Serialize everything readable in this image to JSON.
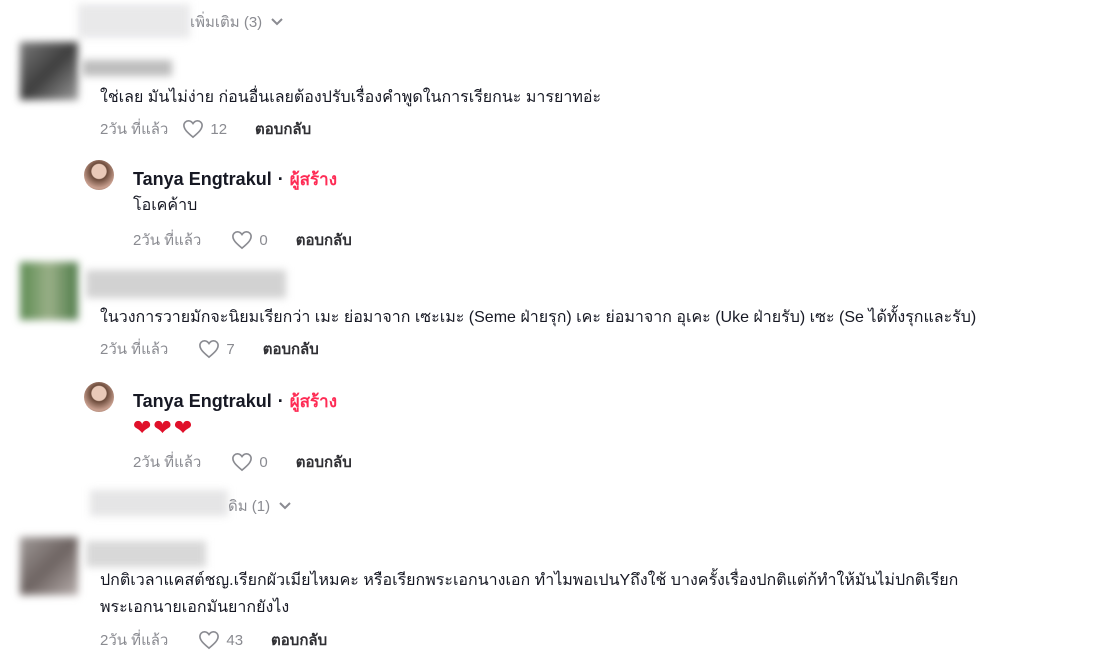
{
  "threads": [
    {
      "more_replies": "เพิ่มเติม (3)",
      "text": "ใช่เลย มันไม่ง่าย ก่อนอื่นเลยต้องปรับเรื่องคำพูดในการเรียกนะ มารยาทอ่ะ",
      "time": "2วัน ที่แล้ว",
      "likes": "12",
      "reply_label": "ตอบกลับ"
    },
    {
      "text": "ในวงการวายมักจะนิยมเรียกว่า เมะ ย่อมาจาก เซะเมะ (Seme ฝ่ายรุก) เคะ ย่อมาจาก อุเคะ (Uke ฝ่ายรับ) เซะ (Se ได้ทั้งรุกและรับ)",
      "time": "2วัน ที่แล้ว",
      "likes": "7",
      "reply_label": "ตอบกลับ"
    },
    {
      "more_replies": "ดิม (1)",
      "text_line1": "ปกติเวลาแคสต์ชญ.เรียกผัวเมียไหมคะ หรือเรียกพระเอกนางเอก ทำไมพอเปนYถึงใช้ บางครั้งเรื่องปกติแต่ก้ทำให้มันไม่ปกติเรียก",
      "text_line2": "พระเอกนายเอกมันยากยังไง",
      "time": "2วัน ที่แล้ว",
      "likes": "43",
      "reply_label": "ตอบกลับ"
    }
  ],
  "creator_replies": [
    {
      "author": "Tanya Engtrakul",
      "separator": "·",
      "badge": "ผู้สร้าง",
      "text": "โอเคค้าบ",
      "time": "2วัน ที่แล้ว",
      "likes": "0",
      "reply_label": "ตอบกลับ"
    },
    {
      "author": "Tanya Engtrakul",
      "separator": "·",
      "badge": "ผู้สร้าง",
      "emoji": "❤❤❤",
      "time": "2วัน ที่แล้ว",
      "likes": "0",
      "reply_label": "ตอบกลับ"
    }
  ],
  "colors": {
    "creator_badge": "#fe2c55",
    "meta": "#8a8b91",
    "heart_emoji": "#e0102a"
  }
}
